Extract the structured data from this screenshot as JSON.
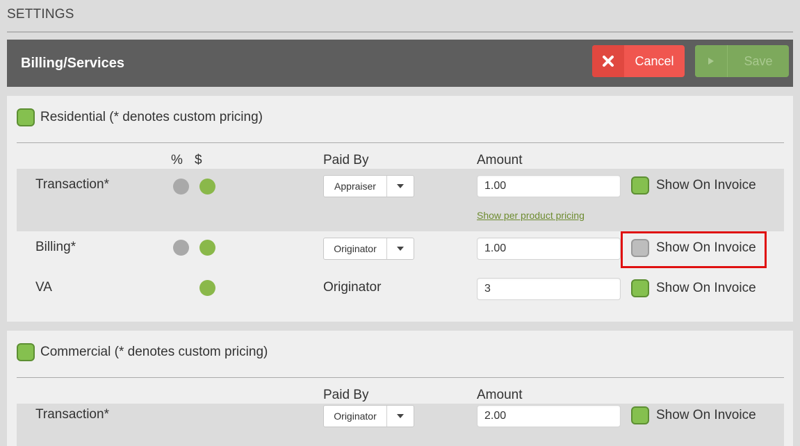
{
  "settings_title": "SETTINGS",
  "header": {
    "title": "Billing/Services",
    "cancel_label": "Cancel",
    "save_label": "Save"
  },
  "residential": {
    "title": "Residential (* denotes custom pricing)",
    "checked": true,
    "columns": {
      "percent": "%",
      "dollar": "$",
      "paid_by": "Paid By",
      "amount": "Amount"
    },
    "rows": [
      {
        "label": "Transaction*",
        "paid_by": "Appraiser",
        "amount": "1.00",
        "show_label": "Show On Invoice",
        "show_checked": true,
        "link": "Show per product pricing"
      },
      {
        "label": "Billing*",
        "paid_by": "Originator",
        "amount": "1.00",
        "show_label": "Show On Invoice",
        "show_checked": false
      },
      {
        "label": "VA",
        "paid_by": "Originator",
        "amount": "3",
        "show_label": "Show On Invoice",
        "show_checked": true
      }
    ]
  },
  "commercial": {
    "title": "Commercial (* denotes custom pricing)",
    "checked": true,
    "columns": {
      "paid_by": "Paid By",
      "amount": "Amount"
    },
    "rows": [
      {
        "label": "Transaction*",
        "paid_by": "Originator",
        "amount": "2.00",
        "show_label": "Show On Invoice",
        "show_checked": true
      }
    ]
  },
  "colors": {
    "header_bg": "#5e5e5e",
    "cancel": "#f0564f",
    "save": "#7da95c",
    "checkbox_on": "#85c04f",
    "highlight": "#e01010"
  }
}
